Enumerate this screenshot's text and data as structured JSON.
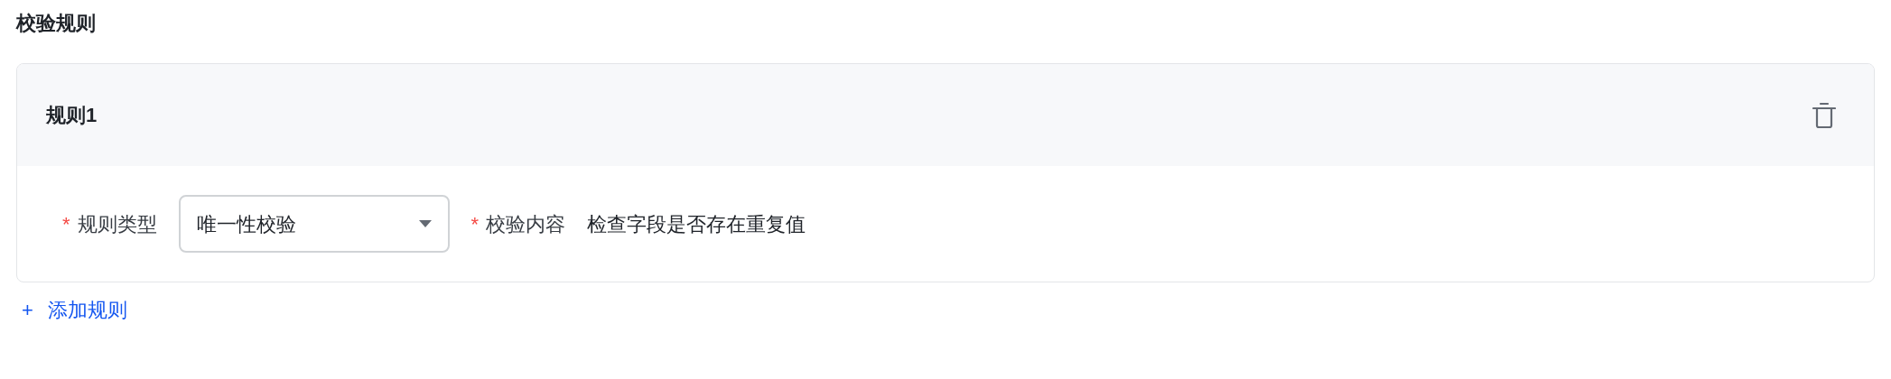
{
  "section_title": "校验规则",
  "rules": [
    {
      "title": "规则1",
      "fields": [
        {
          "kind": "select",
          "label": "规则类型",
          "required_mark": "*",
          "value": "唯一性校验"
        },
        {
          "kind": "text",
          "label": "校验内容",
          "required_mark": "*",
          "value": "检查字段是否存在重复值"
        }
      ]
    }
  ],
  "add_button": {
    "icon": "+",
    "label": "添加规则"
  }
}
